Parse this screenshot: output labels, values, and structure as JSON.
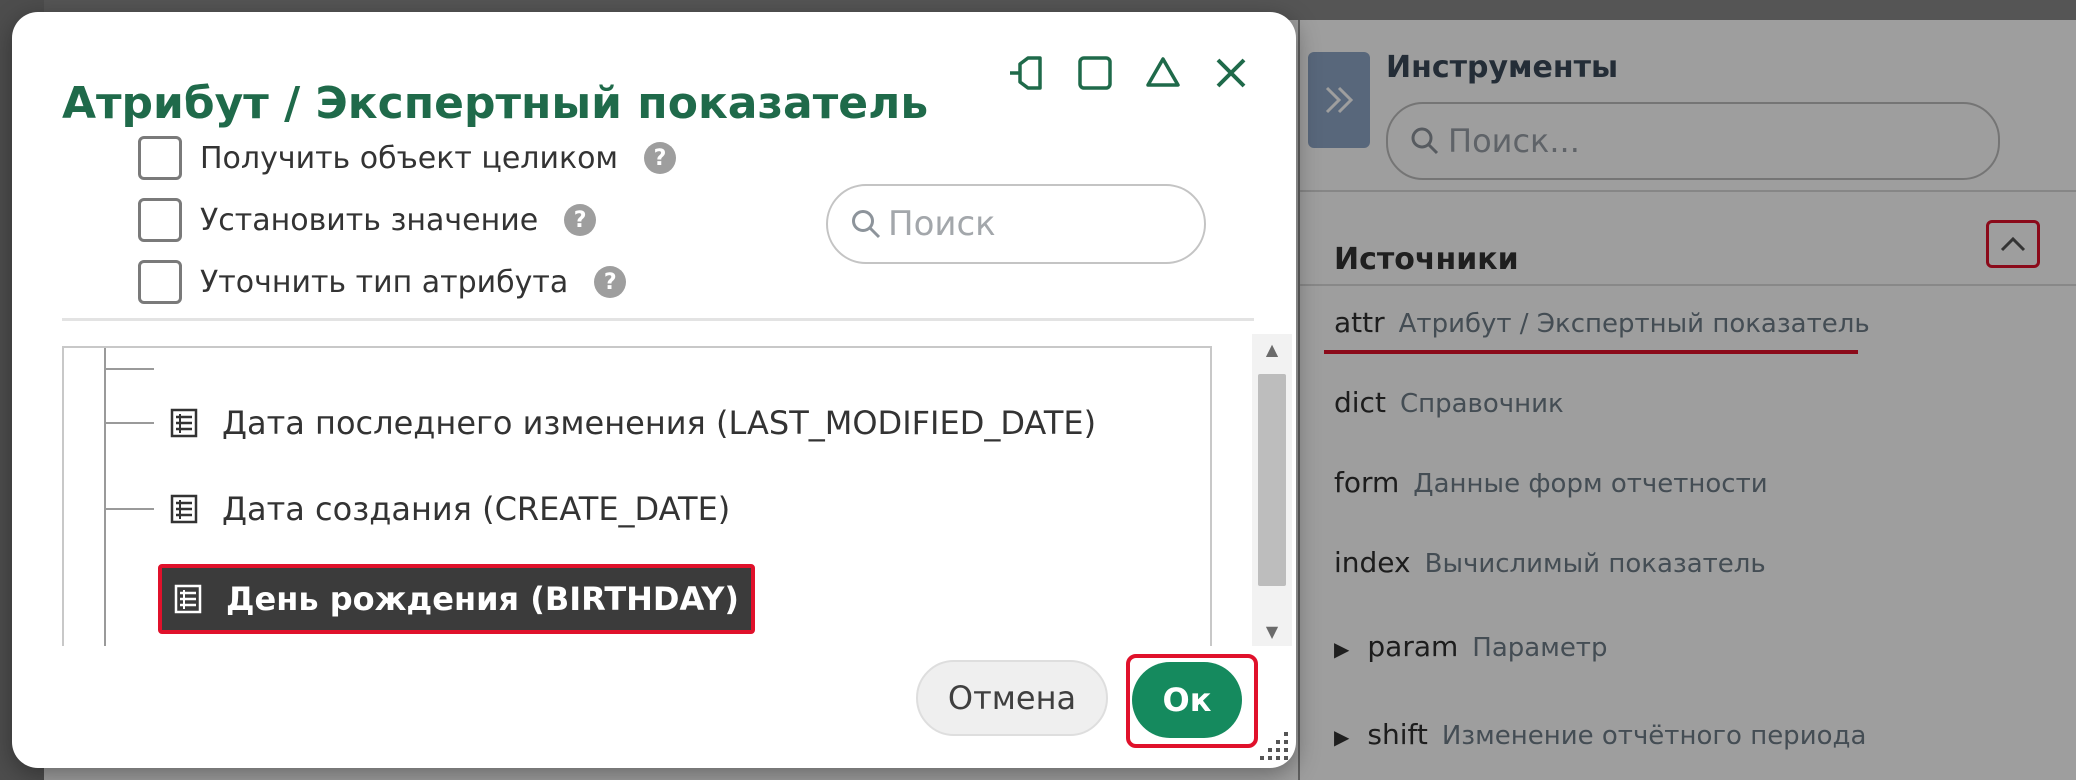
{
  "dialog": {
    "title": "Атрибут / Экспертный показатель",
    "window_controls": [
      "pin-icon",
      "maximize-icon",
      "minimize-icon",
      "close-icon"
    ],
    "options": [
      {
        "label": "Получить объект целиком",
        "checked": false
      },
      {
        "label": "Установить значение",
        "checked": false
      },
      {
        "label": "Уточнить тип атрибута",
        "checked": false
      }
    ],
    "help_glyph": "?",
    "search_placeholder": "Поиск",
    "tree_items": [
      {
        "label": "Дата последнего изменения (LAST_MODIFIED_DATE)",
        "selected": false
      },
      {
        "label": "Дата создания (CREATE_DATE)",
        "selected": false
      },
      {
        "label": "День рождения (BIRTHDAY)",
        "selected": true
      }
    ],
    "cancel_label": "Отмена",
    "ok_label": "Ок"
  },
  "tools_panel": {
    "title": "Инструменты",
    "search_placeholder": "Поиск...",
    "sources_title": "Источники",
    "sources": [
      {
        "code": "attr",
        "desc": "Атрибут / Экспертный показатель",
        "expandable": false
      },
      {
        "code": "dict",
        "desc": "Справочник",
        "expandable": false
      },
      {
        "code": "form",
        "desc": "Данные форм отчетности",
        "expandable": false
      },
      {
        "code": "index",
        "desc": "Вычислимый показатель",
        "expandable": false
      },
      {
        "code": "param",
        "desc": "Параметр",
        "expandable": true
      },
      {
        "code": "shift",
        "desc": "Изменение отчётного периода",
        "expandable": true
      }
    ]
  },
  "colors": {
    "title_green": "#1f6a4a",
    "ok_green": "#158a5e",
    "highlight_red": "#e0112b",
    "selected_bg": "#3b3b3b"
  }
}
